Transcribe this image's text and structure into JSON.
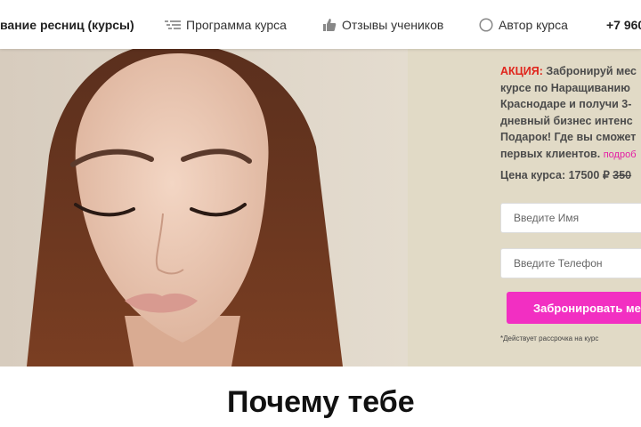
{
  "nav": {
    "brand": "вание ресниц (курсы)",
    "program": {
      "label": "Программа курса",
      "icon": "list-icon"
    },
    "reviews": {
      "label": "Отзывы учеников",
      "icon": "thumbs-up-icon"
    },
    "author": {
      "label": "Автор курса",
      "icon": "circle-icon"
    },
    "phone": "+7 960"
  },
  "hero": {
    "promo_highlight": "АКЦИЯ:",
    "promo_text": " Забронируй мес\nкурсе по Наращиванию\nКраснодаре и получи 3-\nдневный бизнес интенс\nПодарок! Где вы сможет\nпервых клиентов.",
    "promo_more": "подроб",
    "price_label": "Цена курса: 17500 ₽ ",
    "price_old": "350",
    "name_placeholder": "Введите Имя",
    "phone_placeholder": "Введите Телефон",
    "cta_label": "Забронировать ме",
    "installment_note": "*Действует рассрочка на курс"
  },
  "section": {
    "title": "Почему тебе"
  },
  "colors": {
    "accent": "#f22fc2",
    "promo_red": "#e0251c",
    "panel_bg": "#e1dac6",
    "link_pink": "#e41ea4"
  }
}
